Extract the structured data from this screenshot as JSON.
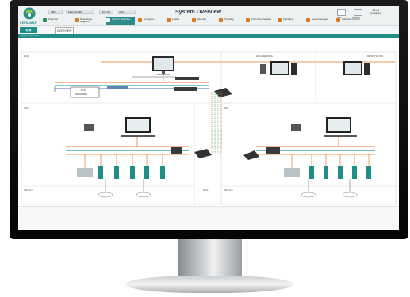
{
  "app": {
    "title": "System Overview",
    "logo_text": "KEPSAMAN"
  },
  "header": {
    "fields": [
      "ABC",
      "MAIN ALERT",
      "B2C DB",
      "ABC"
    ],
    "right_labels": [
      "NAV",
      "ALARM"
    ],
    "clock_time": "12:00",
    "clock_date": "01/01/24"
  },
  "menu": {
    "items": [
      {
        "label": "Diagnost",
        "color": "#2e8b57"
      },
      {
        "label": "Networking Diagram",
        "color": "#d97a1e"
      },
      {
        "label": "System Overview",
        "color": "#2e8b8b"
      },
      {
        "label": "Configure",
        "color": "#d97a1e"
      },
      {
        "label": "Loader",
        "color": "#d97a1e"
      },
      {
        "label": "Security",
        "color": "#d97a1e"
      },
      {
        "label": "Trending",
        "color": "#d97a1e"
      },
      {
        "label": "Calibration Module",
        "color": "#d97a1e"
      },
      {
        "label": "Sampling",
        "color": "#d97a1e"
      },
      {
        "label": "Event Manager",
        "color": "#d97a1e"
      },
      {
        "label": "Historical Archive",
        "color": "#d97a1e"
      }
    ]
  },
  "subtabs": {
    "items": [
      "◉ ◉",
      "OVERVIEW"
    ],
    "strip_label": "System Overview"
  },
  "diagram": {
    "zones": {
      "top_left": "ESN",
      "top_mid": "ENGINEERING",
      "top_right": "REMOTE OPS",
      "mid_left": "SR1",
      "mid_right": "SR2",
      "bottom_left": "SR1 IO's",
      "bottom_mid": "DCS",
      "bottom_right": "SR2 IO's"
    },
    "gateway_label_1": "RTU",
    "gateway_label_2": "NETWORK"
  },
  "colors": {
    "accent": "#1f8e86",
    "network_orange": "#e07b2a",
    "network_teal": "#3aa79a",
    "network_green": "#5cb85c"
  }
}
